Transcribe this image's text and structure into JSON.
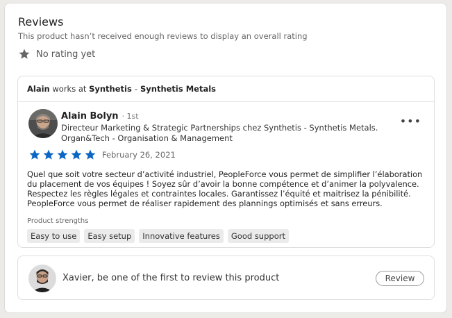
{
  "reviews": {
    "title": "Reviews",
    "subtitle": "This product hasn’t received enough reviews to display an overall rating",
    "rating_text": "No rating yet",
    "works_bar": {
      "name": "Alain",
      "works_at": "works at",
      "company": "Synthetis",
      "separator": "-",
      "company_full": "Synthetis Metals"
    },
    "review": {
      "reviewer_name": "Alain Bolyn",
      "degree": "· 1st",
      "headline": "Directeur Marketing & Strategic Partnerships chez Synthetis - Synthetis Metals. Organ&Tech - Organisation & Management",
      "stars": 5,
      "date": "February 26, 2021",
      "text": "Quel que soit votre secteur d’activité industriel, PeopleForce vous permet de simplifier l’élaboration du placement de vos équipes ! Soyez sûr d’avoir la bonne compétence et d’animer la polyvalence. Respectez les règles légales et contraintes locales. Garantissez l’équité et maitrisez la pénibilité. PeopleForce vous permet de réaliser rapidement des plannings optimisés et sans erreurs.",
      "strengths_label": "Product strengths",
      "strengths": [
        "Easy to use",
        "Easy setup",
        "Innovative features",
        "Good support"
      ],
      "more_icon": "more-horizontal-icon"
    },
    "cta": {
      "text": "Xavier, be one of the first to review this product",
      "button_label": "Review"
    },
    "colors": {
      "star_active": "#0a66c2",
      "star_inactive": "#666666"
    }
  }
}
